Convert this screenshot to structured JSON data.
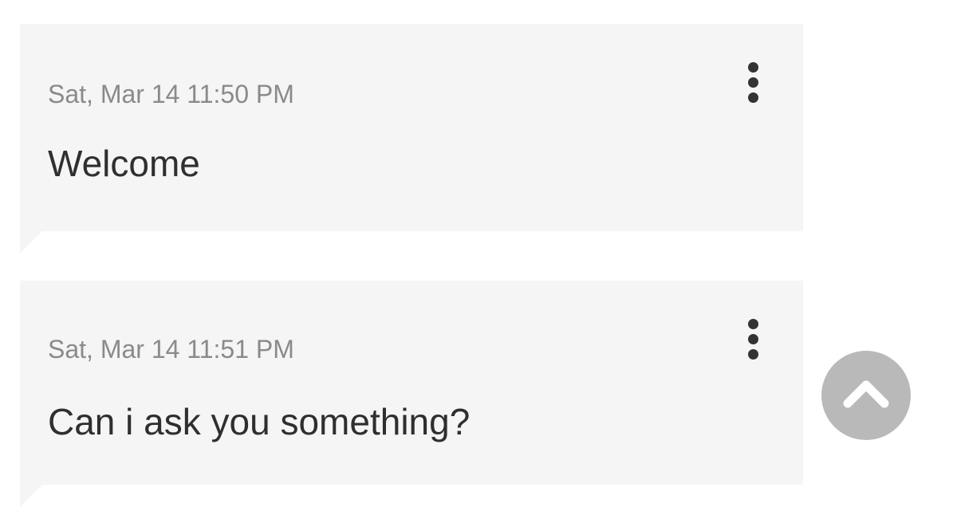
{
  "messages": [
    {
      "timestamp": "Sat, Mar 14 11:50 PM",
      "text": "Welcome",
      "menu_icon": "more-vertical-icon"
    },
    {
      "timestamp": "Sat, Mar 14 11:51 PM",
      "text": "Can i ask you something?",
      "menu_icon": "more-vertical-icon"
    }
  ],
  "scroll_top_button": {
    "icon": "chevron-up-icon",
    "background_color": "#b9b9b9"
  },
  "colors": {
    "bubble_background": "#f5f5f5",
    "timestamp_text": "#8a8a8a",
    "message_text": "#2f2f2f"
  }
}
